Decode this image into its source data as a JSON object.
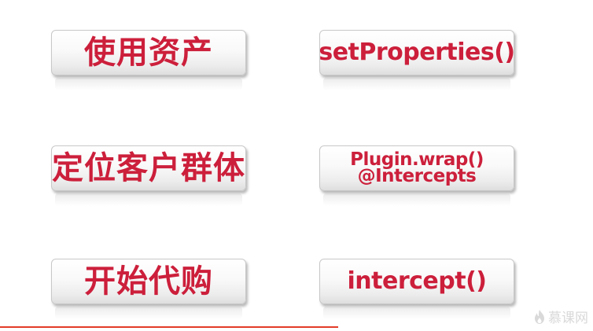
{
  "buttons": {
    "use_assets": "使用资产",
    "set_properties": "setProperties()",
    "target_customers": "定位客户群体",
    "plugin_wrap_line1": "Plugin.wrap()",
    "plugin_wrap_line2": "@Intercepts",
    "start_purchase": "开始代购",
    "intercept": "intercept()"
  },
  "watermark": {
    "text": "慕课网",
    "icon": "flame-logo-icon"
  },
  "colors": {
    "text_accent": "#cc1f3b",
    "bottom_line": "#e23c28",
    "watermark": "#d9d9d9"
  }
}
